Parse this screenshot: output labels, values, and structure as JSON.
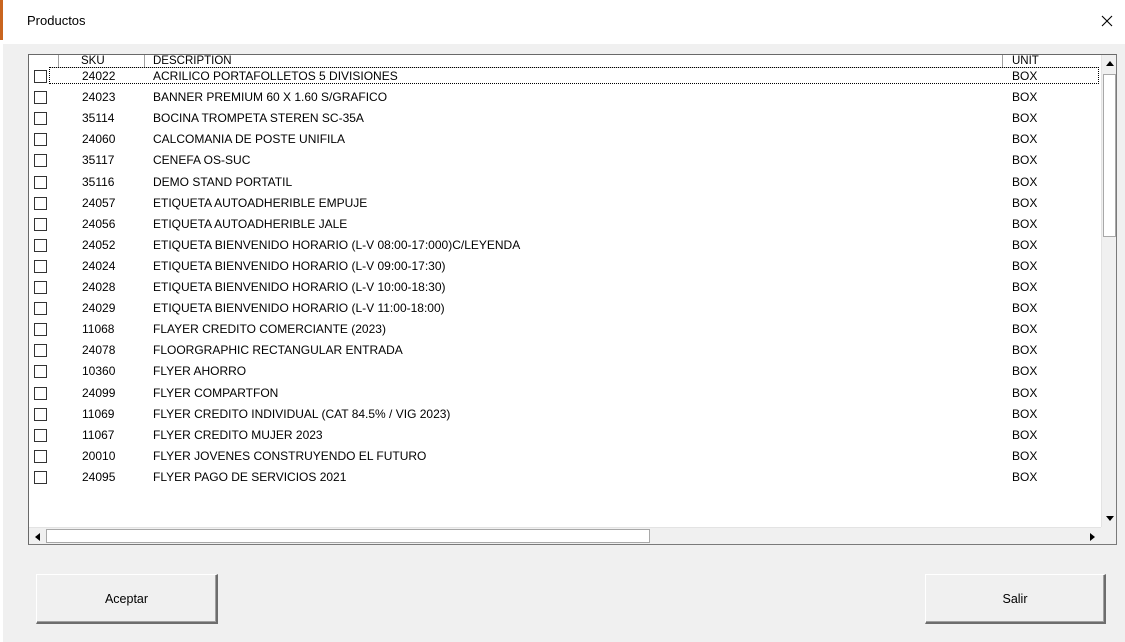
{
  "window": {
    "title": "Productos",
    "close_icon": "close-icon"
  },
  "table": {
    "columns": [
      "SKU",
      "DESCRIPTION",
      "UNIT"
    ],
    "rows": [
      {
        "sku": "24022",
        "description": "ACRILICO PORTAFOLLETOS 5 DIVISIONES",
        "unit": "BOX"
      },
      {
        "sku": "24023",
        "description": "BANNER PREMIUM 60 X 1.60 S/GRAFICO",
        "unit": "BOX"
      },
      {
        "sku": "35114",
        "description": "BOCINA TROMPETA STEREN  SC-35A",
        "unit": "BOX"
      },
      {
        "sku": "24060",
        "description": "CALCOMANIA DE POSTE UNIFILA",
        "unit": "BOX"
      },
      {
        "sku": "35117",
        "description": "CENEFA OS-SUC",
        "unit": "BOX"
      },
      {
        "sku": "35116",
        "description": "DEMO STAND PORTATIL",
        "unit": "BOX"
      },
      {
        "sku": "24057",
        "description": "ETIQUETA AUTOADHERIBLE EMPUJE",
        "unit": "BOX"
      },
      {
        "sku": "24056",
        "description": "ETIQUETA AUTOADHERIBLE JALE",
        "unit": "BOX"
      },
      {
        "sku": "24052",
        "description": "ETIQUETA BIENVENIDO HORARIO (L-V 08:00-17:000)C/LEYENDA",
        "unit": "BOX"
      },
      {
        "sku": "24024",
        "description": "ETIQUETA BIENVENIDO HORARIO (L-V 09:00-17:30)",
        "unit": "BOX"
      },
      {
        "sku": "24028",
        "description": "ETIQUETA BIENVENIDO HORARIO (L-V 10:00-18:30)",
        "unit": "BOX"
      },
      {
        "sku": "24029",
        "description": "ETIQUETA BIENVENIDO HORARIO (L-V 11:00-18:00)",
        "unit": "BOX"
      },
      {
        "sku": "11068",
        "description": "FLAYER CREDITO COMERCIANTE (2023)",
        "unit": "BOX"
      },
      {
        "sku": "24078",
        "description": "FLOORGRAPHIC RECTANGULAR ENTRADA",
        "unit": "BOX"
      },
      {
        "sku": "10360",
        "description": "FLYER AHORRO",
        "unit": "BOX"
      },
      {
        "sku": "24099",
        "description": "FLYER COMPARTFON",
        "unit": "BOX"
      },
      {
        "sku": "11069",
        "description": "FLYER CREDITO INDIVIDUAL (CAT 84.5% / VIG 2023)",
        "unit": "BOX"
      },
      {
        "sku": "11067",
        "description": "FLYER CREDITO MUJER 2023",
        "unit": "BOX"
      },
      {
        "sku": "20010",
        "description": "FLYER JOVENES CONSTRUYENDO EL FUTURO",
        "unit": "BOX"
      },
      {
        "sku": "24095",
        "description": "FLYER PAGO DE SERVICIOS 2021",
        "unit": "BOX"
      }
    ]
  },
  "buttons": {
    "accept_label": "Aceptar",
    "exit_label": "Salir"
  }
}
